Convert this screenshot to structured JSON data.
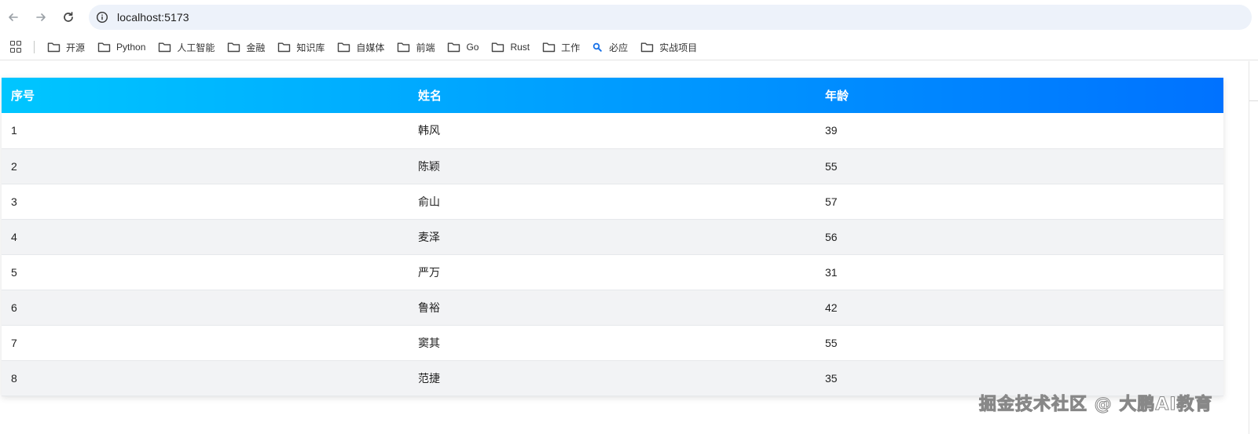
{
  "browser": {
    "url": "localhost:5173",
    "bookmarks": [
      {
        "label": "开源",
        "icon": "folder-icon"
      },
      {
        "label": "Python",
        "icon": "folder-icon"
      },
      {
        "label": "人工智能",
        "icon": "folder-icon"
      },
      {
        "label": "金融",
        "icon": "folder-icon"
      },
      {
        "label": "知识库",
        "icon": "folder-icon"
      },
      {
        "label": "自媒体",
        "icon": "folder-icon"
      },
      {
        "label": "前端",
        "icon": "folder-icon"
      },
      {
        "label": "Go",
        "icon": "folder-icon"
      },
      {
        "label": "Rust",
        "icon": "folder-icon"
      },
      {
        "label": "工作",
        "icon": "folder-icon"
      },
      {
        "label": "必应",
        "icon": "search-icon"
      },
      {
        "label": "实战项目",
        "icon": "folder-icon"
      }
    ]
  },
  "table": {
    "headers": [
      "序号",
      "姓名",
      "年龄"
    ],
    "rows": [
      [
        "1",
        "韩风",
        "39"
      ],
      [
        "2",
        "陈颖",
        "55"
      ],
      [
        "3",
        "俞山",
        "57"
      ],
      [
        "4",
        "麦泽",
        "56"
      ],
      [
        "5",
        "严万",
        "31"
      ],
      [
        "6",
        "鲁裕",
        "42"
      ],
      [
        "7",
        "窦其",
        "55"
      ],
      [
        "8",
        "范捷",
        "35"
      ]
    ],
    "header_gradient": [
      "#00c6ff",
      "#0072ff"
    ]
  },
  "watermark": "掘金技术社区 @ 大鹏AI教育"
}
